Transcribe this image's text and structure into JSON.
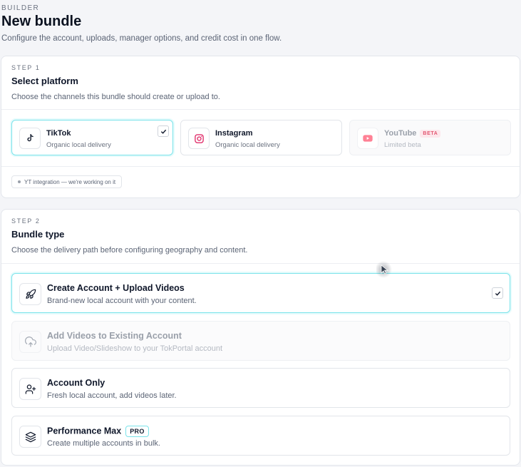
{
  "header": {
    "eyebrow": "BUILDER",
    "title": "New bundle",
    "subtitle": "Configure the account, uploads, manager options, and credit cost in one flow."
  },
  "step1": {
    "step_label": "STEP 1",
    "title": "Select platform",
    "subtitle": "Choose the channels this bundle should create or upload to.",
    "platforms": [
      {
        "name": "TikTok",
        "desc": "Organic local delivery",
        "icon": "tiktok-icon",
        "selected": true
      },
      {
        "name": "Instagram",
        "desc": "Organic local delivery",
        "icon": "instagram-icon",
        "selected": false
      },
      {
        "name": "YouTube",
        "desc": "Limited beta",
        "badge": "BETA",
        "icon": "youtube-icon",
        "disabled": true
      }
    ],
    "notice": "YT integration — we're working on it"
  },
  "step2": {
    "step_label": "STEP 2",
    "title": "Bundle type",
    "subtitle": "Choose the delivery path before configuring geography and content.",
    "options": [
      {
        "name": "Create Account + Upload Videos",
        "desc": "Brand-new local account with your content.",
        "icon": "rocket-icon",
        "selected": true
      },
      {
        "name": "Add Videos to Existing Account",
        "desc": "Upload Video/Slideshow to your TokPortal account",
        "icon": "cloud-upload-icon",
        "disabled": true
      },
      {
        "name": "Account Only",
        "desc": "Fresh local account, add videos later.",
        "icon": "user-plus-icon"
      },
      {
        "name": "Performance Max",
        "badge": "PRO",
        "desc": "Create multiple accounts in bulk.",
        "icon": "layers-icon"
      }
    ]
  },
  "colors": {
    "accent": "#7be3ea",
    "instagram": "#e1306c",
    "youtube": "#ff6b81",
    "beta": "#e25570"
  }
}
